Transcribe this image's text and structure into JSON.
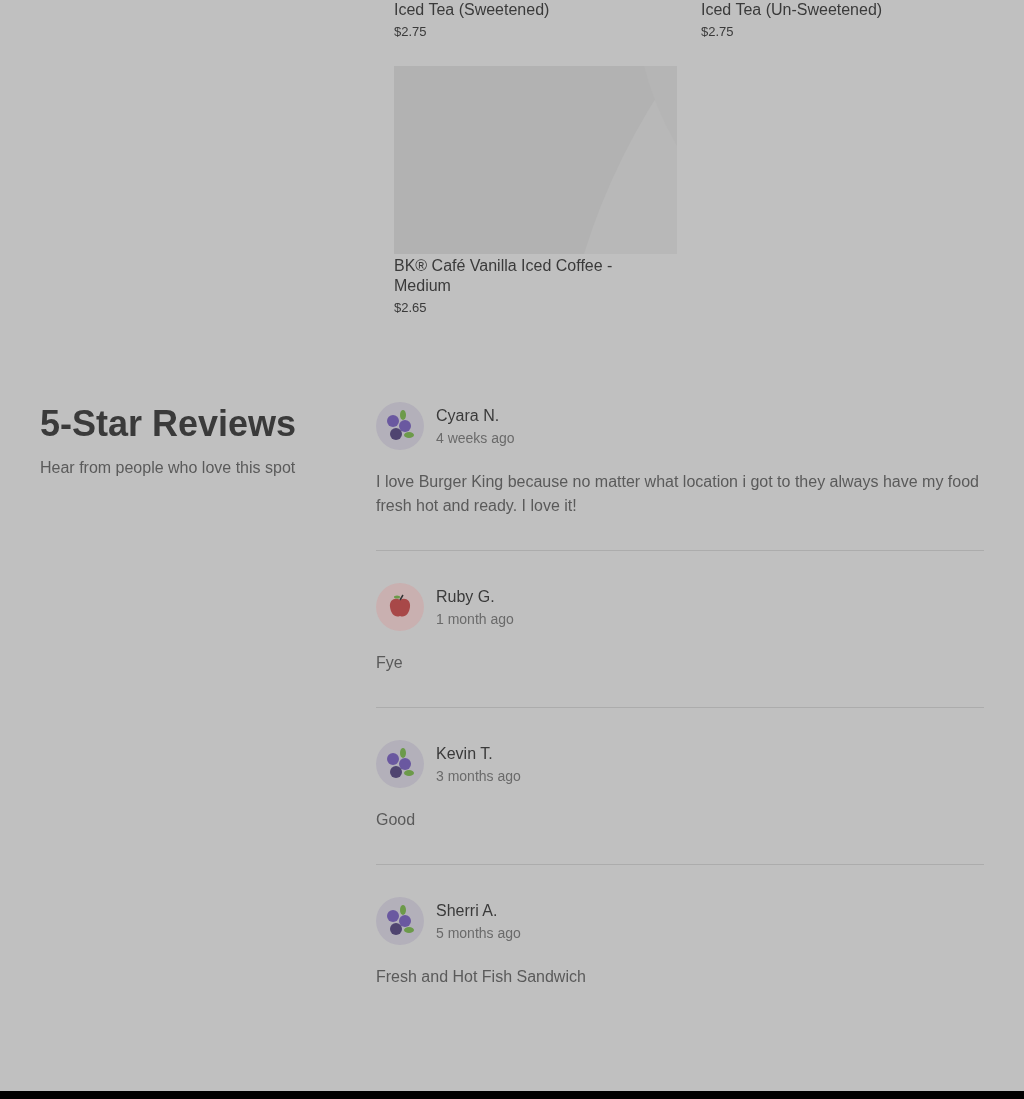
{
  "products": [
    {
      "name": "Iced Tea (Sweetened)",
      "price": "$2.75",
      "kind": "text"
    },
    {
      "name": "Iced Tea (Un-Sweetened)",
      "price": "$2.75",
      "kind": "text"
    },
    {
      "name": "BK® Café Vanilla Iced Coffee - Medium",
      "price": "$2.65",
      "kind": "picture"
    }
  ],
  "reviews_section": {
    "title": "5-Star Reviews",
    "subtitle": "Hear from people who love this spot"
  },
  "reviews": [
    {
      "name": "Cyara N.",
      "time": "4 weeks ago",
      "kind": "blueberry",
      "text": "I love Burger King because no matter what location i got to they always have my food fresh hot and ready. I love it!"
    },
    {
      "name": "Ruby G.",
      "time": "1 month ago",
      "kind": "apple",
      "text": "Fye"
    },
    {
      "name": "Kevin T.",
      "time": "3 months ago",
      "kind": "blueberry",
      "text": "Good"
    },
    {
      "name": "Sherri A.",
      "time": "5 months ago",
      "kind": "blueberry",
      "text": "Fresh and Hot Fish Sandwich"
    }
  ]
}
